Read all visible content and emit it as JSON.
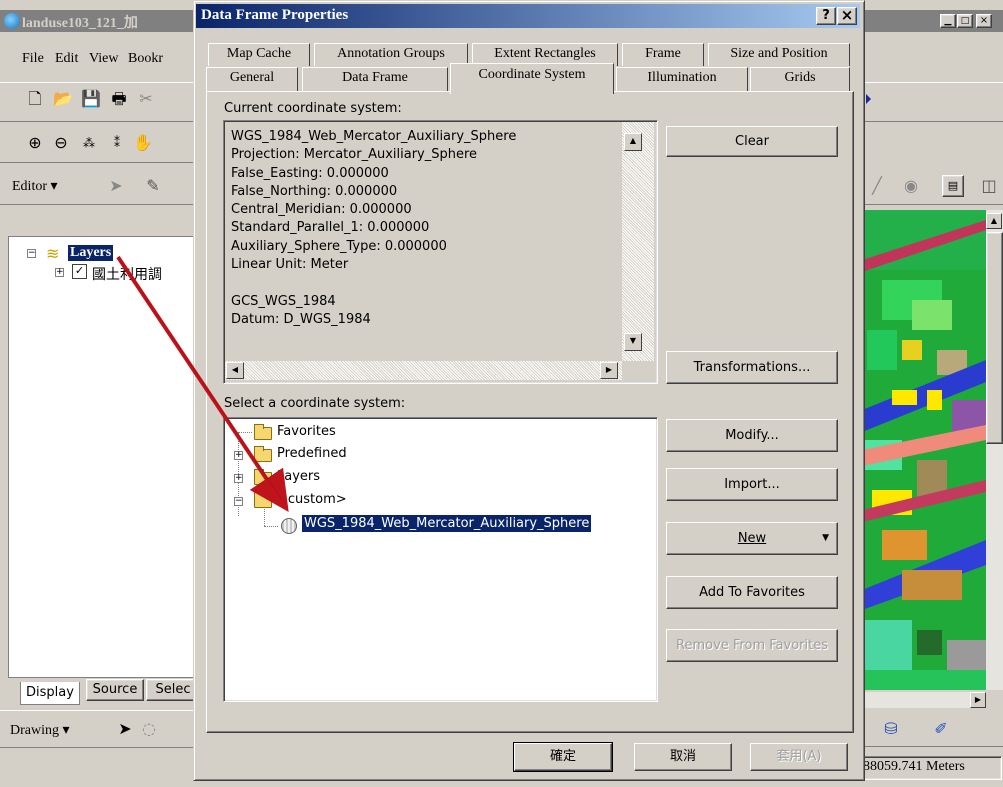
{
  "app": {
    "title": "landuse103_121_加",
    "menu": [
      "File",
      "Edit",
      "View",
      "Bookr"
    ],
    "editor_label": "Editor ▾",
    "toc": {
      "root_label": "Layers",
      "layer_label": "國土利用調",
      "tabs": [
        "Display",
        "Source",
        "Selec"
      ]
    },
    "drawing_label": "Drawing ▾",
    "status_text": "88059.741 Meters"
  },
  "dialog": {
    "title": "Data Frame Properties",
    "help_btn": "?",
    "close_btn": "×",
    "tabs_row1": [
      "Map Cache",
      "Annotation Groups",
      "Extent Rectangles",
      "Frame",
      "Size and Position"
    ],
    "tabs_row2": [
      "General",
      "Data Frame",
      "Coordinate System",
      "Illumination",
      "Grids"
    ],
    "active_tab": "Coordinate System",
    "current_label": "Current coordinate system:",
    "current_text": [
      "WGS_1984_Web_Mercator_Auxiliary_Sphere",
      "Projection: Mercator_Auxiliary_Sphere",
      "False_Easting: 0.000000",
      "False_Northing: 0.000000",
      "Central_Meridian: 0.000000",
      "Standard_Parallel_1: 0.000000",
      "Auxiliary_Sphere_Type: 0.000000",
      "Linear Unit: Meter",
      "",
      "GCS_WGS_1984",
      "Datum: D_WGS_1984"
    ],
    "select_label": "Select a coordinate system:",
    "tree": {
      "favorites": "Favorites",
      "predefined": "Predefined",
      "layers": "Layers",
      "custom": "<custom>",
      "selected": "WGS_1984_Web_Mercator_Auxiliary_Sphere"
    },
    "buttons": {
      "clear": "Clear",
      "transformations": "Transformations...",
      "modify": "Modify...",
      "import": "Import...",
      "new": "New",
      "add_fav": "Add To Favorites",
      "remove_fav": "Remove From Favorites"
    },
    "footer": {
      "ok": "確定",
      "cancel": "取消",
      "apply": "套用(A)"
    }
  }
}
